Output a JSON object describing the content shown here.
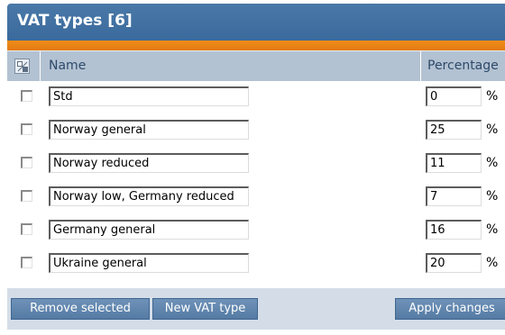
{
  "panel": {
    "title": "VAT types [6]"
  },
  "table": {
    "columns": {
      "name": "Name",
      "percentage": "Percentage"
    },
    "percent_symbol": "%",
    "rows": [
      {
        "name": "Std",
        "percentage": "0",
        "checked": false
      },
      {
        "name": "Norway general",
        "percentage": "25",
        "checked": false
      },
      {
        "name": "Norway reduced",
        "percentage": "11",
        "checked": false
      },
      {
        "name": "Norway low, Germany reduced",
        "percentage": "7",
        "checked": false
      },
      {
        "name": "Germany general",
        "percentage": "16",
        "checked": false
      },
      {
        "name": "Ukraine general",
        "percentage": "20",
        "checked": false
      }
    ]
  },
  "footer": {
    "remove_label": "Remove selected",
    "new_label": "New VAT type",
    "apply_label": "Apply changes"
  },
  "colors": {
    "title_bar": "#3a6a9c",
    "accent_strip": "#f08d1a",
    "header_row": "#b3c2d2",
    "button": "#5f84ad"
  }
}
